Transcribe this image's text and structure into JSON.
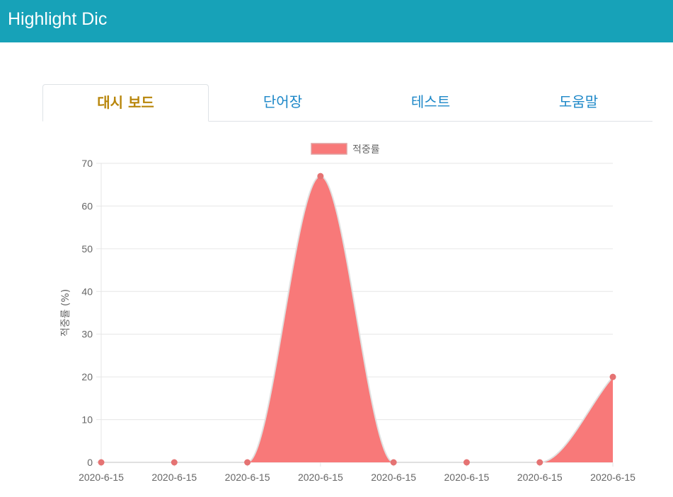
{
  "app": {
    "title": "Highlight Dic",
    "bar_color": "#17a2b8"
  },
  "tabs": [
    {
      "label": "대시 보드",
      "active": true,
      "color": "#b8860b"
    },
    {
      "label": "단어장",
      "active": false,
      "color": "#1e88c8"
    },
    {
      "label": "테스트",
      "active": false,
      "color": "#1e88c8"
    },
    {
      "label": "도움말",
      "active": false,
      "color": "#1e88c8"
    }
  ],
  "chart_data": {
    "type": "area",
    "ylabel": "적중률 (%)",
    "xlabel": "",
    "ylim": [
      0,
      70
    ],
    "yticks": [
      0,
      10,
      20,
      30,
      40,
      50,
      60,
      70
    ],
    "grid": true,
    "legend_position": "top-center",
    "categories": [
      "2020-6-15",
      "2020-6-15",
      "2020-6-15",
      "2020-6-15",
      "2020-6-15",
      "2020-6-15",
      "2020-6-15",
      "2020-6-15"
    ],
    "series": [
      {
        "name": "적중률",
        "values": [
          0,
          0,
          0,
          67,
          0,
          0,
          0,
          20
        ],
        "fill_color": "#f87979",
        "line_color": "#e0e0e0"
      }
    ]
  }
}
